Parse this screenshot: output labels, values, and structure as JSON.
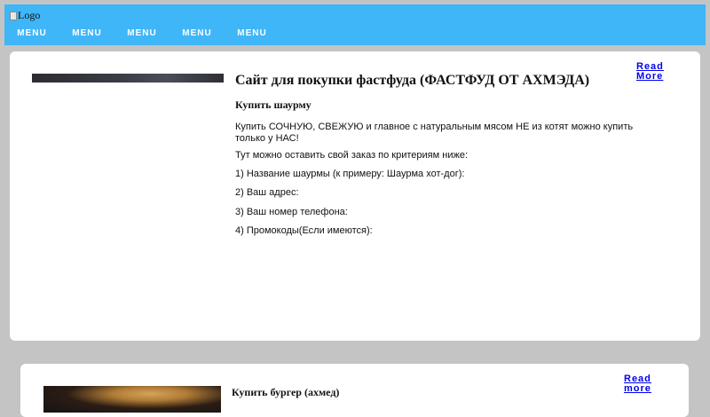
{
  "header": {
    "logo_alt": "Logo",
    "menu": [
      "MENU",
      "MENU",
      "MENU",
      "MENU",
      "MENU"
    ]
  },
  "card1": {
    "title": "Сайт для покупки фастфуда (ФАСТФУД ОТ АХМЭДА)",
    "subtitle": "Купить шаурму",
    "paragraphs": [
      "Купить СОЧНУЮ, СВЕЖУЮ и главное с натуральным мясом НЕ из котят можно купить только у НАС!",
      "Тут можно оставить свой заказ по критериям ниже:",
      "1) Название шаурмы (к примеру: Шаурма хот-дог):",
      "2) Ваш адрес:",
      "3) Ваш номер телефона:",
      "4) Промокоды(Если имеются):"
    ],
    "read_more": [
      "Read",
      "More"
    ]
  },
  "card2": {
    "subtitle": "Купить бургер (ахмед)",
    "read_more": [
      "Read",
      "more"
    ]
  },
  "colors": {
    "header_bg": "#3fb6f7",
    "page_bg": "#c4c4c4",
    "link": "#0000ee"
  }
}
